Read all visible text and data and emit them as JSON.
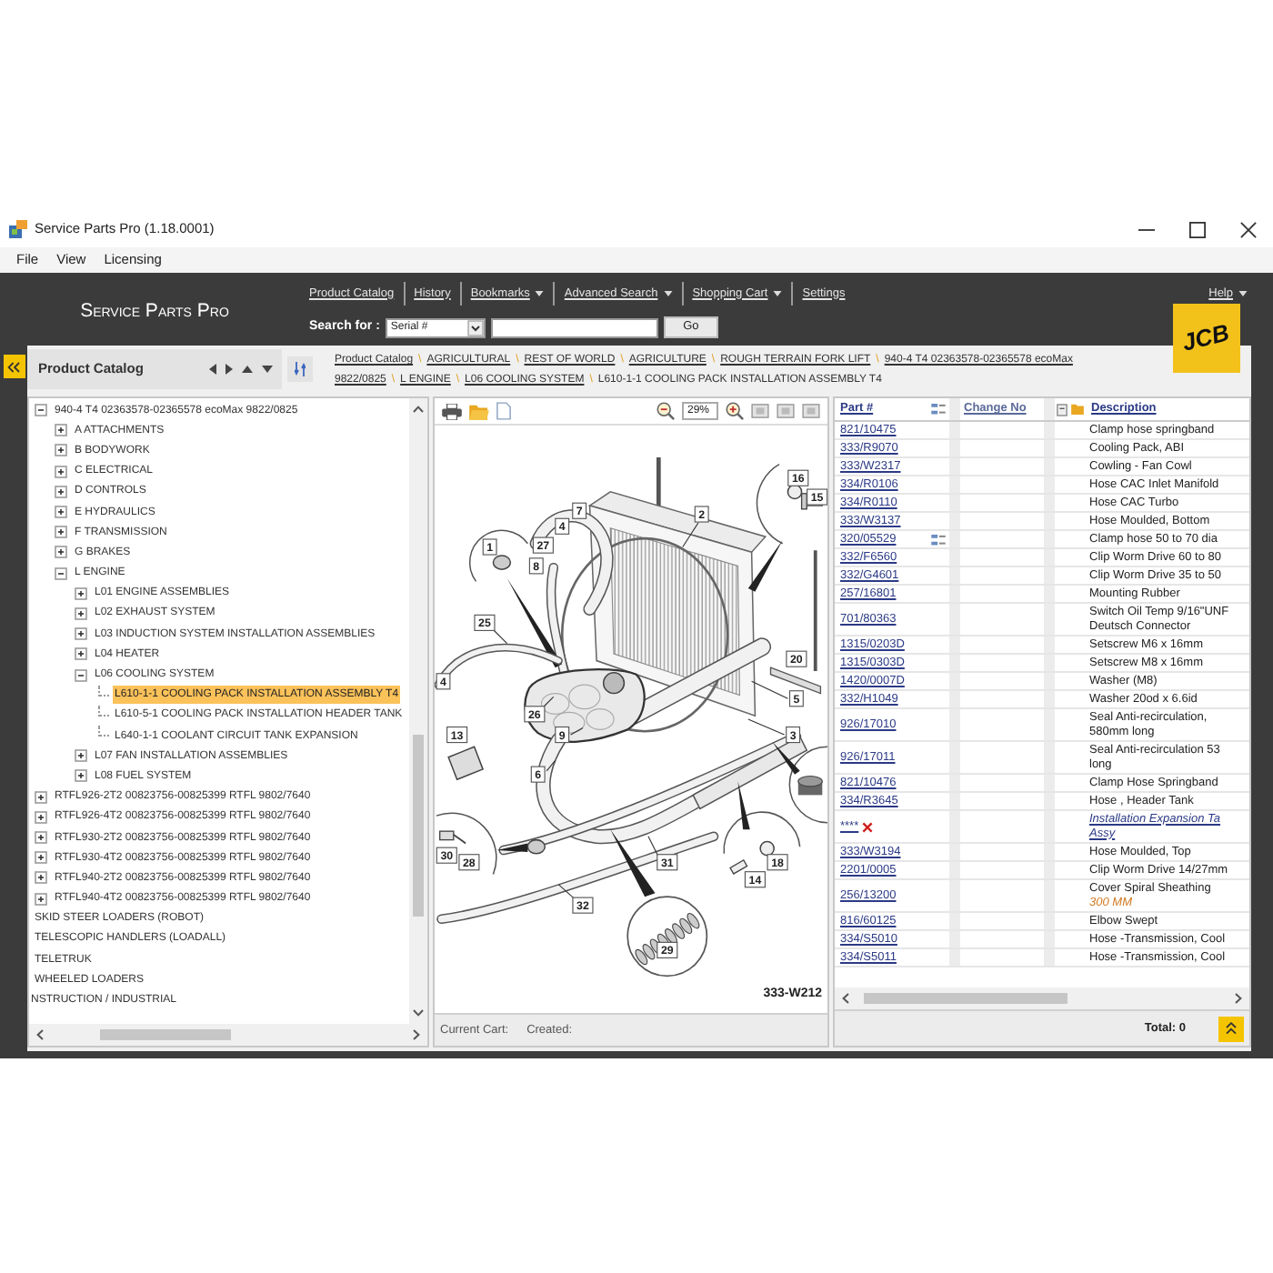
{
  "window": {
    "title": "Service Parts Pro (1.18.0001)"
  },
  "menu": [
    "File",
    "View",
    "Licensing"
  ],
  "header": {
    "brand": "Service Parts Pro",
    "nav": [
      {
        "label": "Product Catalog",
        "dropdown": false
      },
      {
        "label": "History",
        "dropdown": false
      },
      {
        "label": "Bookmarks",
        "dropdown": true
      },
      {
        "label": "Advanced Search",
        "dropdown": true
      },
      {
        "label": "Shopping Cart",
        "dropdown": true
      },
      {
        "label": "Settings",
        "dropdown": false
      }
    ],
    "help": {
      "label": "Help",
      "dropdown": true
    },
    "search": {
      "label": "Search for :",
      "type": "Serial #",
      "go": "Go"
    },
    "logo": "JCB"
  },
  "catalog": {
    "title": "Product Catalog",
    "tree": [
      {
        "children": [
          {
            "children": [
              {
                "label": "940-4 T4 02363578-02365578 ecoMax 9822/0825",
                "expanded": true,
                "selected": false,
                "children": [
                  {
                    "label": "A ATTACHMENTS",
                    "expanded": false,
                    "selected": false
                  },
                  {
                    "label": "B BODYWORK",
                    "expanded": false,
                    "selected": false
                  },
                  {
                    "label": "C ELECTRICAL",
                    "expanded": false,
                    "selected": false
                  },
                  {
                    "label": "D CONTROLS",
                    "expanded": false,
                    "selected": false
                  },
                  {
                    "label": "E HYDRAULICS",
                    "expanded": false,
                    "selected": false
                  },
                  {
                    "label": "F TRANSMISSION",
                    "expanded": false,
                    "selected": false
                  },
                  {
                    "label": "G BRAKES",
                    "expanded": false,
                    "selected": false
                  },
                  {
                    "label": "L ENGINE",
                    "expanded": true,
                    "selected": false,
                    "children": [
                      {
                        "label": "L01 ENGINE ASSEMBLIES",
                        "expanded": false,
                        "selected": false
                      },
                      {
                        "label": "L02 EXHAUST SYSTEM",
                        "expanded": false,
                        "selected": false
                      },
                      {
                        "label": "L03 INDUCTION SYSTEM INSTALLATION ASSEMBLIES",
                        "expanded": false,
                        "selected": false
                      },
                      {
                        "label": "L04 HEATER",
                        "expanded": false,
                        "selected": false
                      },
                      {
                        "label": "L06 COOLING SYSTEM",
                        "expanded": true,
                        "selected": false,
                        "children": [
                          {
                            "label": "L610-1-1 COOLING PACK INSTALLATION ASSEMBLY T4",
                            "selected": true
                          },
                          {
                            "label": "L610-5-1 COOLING PACK INSTALLATION HEADER TANK",
                            "selected": false
                          },
                          {
                            "label": "L640-1-1 COOLANT CIRCUIT TANK EXPANSION",
                            "selected": false
                          }
                        ]
                      },
                      {
                        "label": "L07 FAN INSTALLATION ASSEMBLIES",
                        "expanded": false,
                        "selected": false
                      },
                      {
                        "label": "L08 FUEL SYSTEM",
                        "expanded": false,
                        "selected": false
                      }
                    ]
                  }
                ]
              },
              {
                "label": "RTFL926-2T2 00823756-00825399 RTFL 9802/7640",
                "expanded": false,
                "selected": false
              },
              {
                "label": "RTFL926-4T2 00823756-00825399 RTFL 9802/7640",
                "expanded": false,
                "selected": false
              },
              {
                "label": "RTFL930-2T2 00823756-00825399 RTFL 9802/7640",
                "expanded": false,
                "selected": false
              },
              {
                "label": "RTFL930-4T2 00823756-00825399 RTFL 9802/7640",
                "expanded": false,
                "selected": false
              },
              {
                "label": "RTFL940-2T2 00823756-00825399 RTFL 9802/7640",
                "expanded": false,
                "selected": false
              },
              {
                "label": "RTFL940-4T2 00823756-00825399 RTFL 9802/7640",
                "expanded": false,
                "selected": false
              }
            ]
          },
          {
            "label": "SKID STEER LOADERS (ROBOT)",
            "selected": false
          },
          {
            "label": "TELESCOPIC HANDLERS (LOADALL)",
            "selected": false
          },
          {
            "label": "TELETRUK",
            "selected": false
          },
          {
            "label": "WHEELED LOADERS",
            "selected": false
          }
        ]
      },
      {
        "label": "NSTRUCTION / INDUSTRIAL",
        "selected": false
      }
    ]
  },
  "breadcrumb": {
    "lines": [
      [
        {
          "text": "Product Catalog",
          "link": true,
          "sep": "\\"
        },
        {
          "text": "AGRICULTURAL",
          "link": true,
          "sep": "\\"
        },
        {
          "text": "REST OF WORLD",
          "link": true,
          "sep": "\\"
        },
        {
          "text": "AGRICULTURE",
          "link": true,
          "sep": "\\"
        },
        {
          "text": "ROUGH TERRAIN FORK LIFT",
          "link": true,
          "sep": "\\"
        },
        {
          "text": "940-4 T4 02363578-02365578 ecoMax",
          "link": true
        }
      ],
      [
        {
          "text": "9822/0825",
          "link": true,
          "sep": "\\"
        },
        {
          "text": "L ENGINE",
          "link": true,
          "sep": "\\"
        },
        {
          "text": "L06 COOLING SYSTEM",
          "link": true,
          "sep": "\\"
        },
        {
          "text": "L610-1-1 COOLING PACK INSTALLATION ASSEMBLY T4",
          "link": false
        }
      ]
    ]
  },
  "diagram": {
    "zoom": "29%",
    "callouts": [
      "16",
      "15",
      "7",
      "2",
      "4",
      "1",
      "27",
      "8",
      "25",
      "20",
      "4",
      "5",
      "26",
      "13",
      "9",
      "3",
      "6",
      "30",
      "28",
      "31",
      "18",
      "14",
      "32",
      "29"
    ],
    "code": "333-W212",
    "status": {
      "cart_label": "Current Cart:",
      "created_label": "Created:"
    }
  },
  "parts_table": {
    "columns": [
      "Part #",
      "Change No",
      "Description"
    ],
    "rows": [
      {
        "part": "821/10475",
        "description": "Clamp hose springband",
        "kind": "part",
        "changed": false
      },
      {
        "part": "333/R9070",
        "description": "Cooling Pack, ABI",
        "kind": "part",
        "changed": false
      },
      {
        "part": "333/W2317",
        "description": "Cowling - Fan Cowl",
        "kind": "part",
        "changed": false
      },
      {
        "part": "334/R0106",
        "description": "Hose CAC Inlet Manifold",
        "kind": "part",
        "changed": false
      },
      {
        "part": "334/R0110",
        "description": "Hose CAC Turbo",
        "kind": "part",
        "changed": false
      },
      {
        "part": "333/W3137",
        "description": "Hose Moulded, Bottom",
        "kind": "part",
        "changed": false
      },
      {
        "part": "320/05529",
        "description": "Clamp hose 50 to 70 dia",
        "kind": "part",
        "changed": true
      },
      {
        "part": "332/F6560",
        "description": "Clip Worm Drive 60 to 80",
        "kind": "part",
        "changed": false
      },
      {
        "part": "332/G4601",
        "description": "Clip Worm Drive 35 to 50",
        "kind": "part",
        "changed": false
      },
      {
        "part": "257/16801",
        "description": "Mounting Rubber",
        "kind": "part",
        "changed": false
      },
      {
        "part": "701/80363",
        "description": [
          "Switch Oil Temp 9/16\"UNF",
          "Deutsch Connector"
        ],
        "kind": "part",
        "changed": false
      },
      {
        "part": "1315/0203D",
        "description": "Setscrew M6 x 16mm",
        "kind": "part",
        "changed": false
      },
      {
        "part": "1315/0303D",
        "description": "Setscrew M8 x 16mm",
        "kind": "part",
        "changed": false
      },
      {
        "part": "1420/0007D",
        "description": "Washer (M8)",
        "kind": "part",
        "changed": false
      },
      {
        "part": "332/H1049",
        "description": "Washer 20od x 6.6id",
        "kind": "part",
        "changed": false
      },
      {
        "part": "926/17010",
        "description": [
          "Seal Anti-recirculation,",
          "580mm long"
        ],
        "kind": "part",
        "changed": false
      },
      {
        "part": "926/17011",
        "description": [
          "Seal Anti-recirculation 53",
          "long"
        ],
        "kind": "part",
        "changed": false
      },
      {
        "part": "821/10476",
        "description": "Clamp Hose Springband",
        "kind": "part",
        "changed": false
      },
      {
        "part": "334/R3645",
        "description": "Hose , Header Tank",
        "kind": "part",
        "changed": false
      },
      {
        "part": "****",
        "description": [
          "Installation Expansion Ta",
          "Assy"
        ],
        "kind": "kit",
        "changed": false
      },
      {
        "part": "333/W3194",
        "description": "Hose Moulded, Top",
        "kind": "part",
        "changed": false
      },
      {
        "part": "2201/0005",
        "description": "Clip Worm Drive 14/27mm",
        "kind": "part",
        "changed": false
      },
      {
        "part": "256/13200",
        "description": "Cover Spiral Sheathing",
        "note": "300 MM",
        "kind": "part",
        "changed": false
      },
      {
        "part": "816/60125",
        "description": "Elbow Swept",
        "kind": "part",
        "changed": false
      },
      {
        "part": "334/S5010",
        "description": "Hose -Transmission, Cool",
        "kind": "part",
        "changed": false
      },
      {
        "part": "334/S5011",
        "description": "Hose -Transmission, Cool",
        "kind": "part",
        "changed": false
      }
    ],
    "total": "Total: 0"
  }
}
